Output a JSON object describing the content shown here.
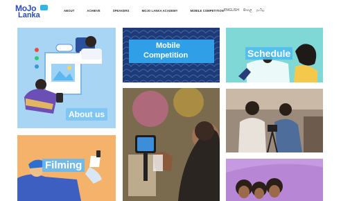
{
  "logo": {
    "line1": "MoJo",
    "line2": "Lanka"
  },
  "nav": {
    "items": [
      "ABOUT",
      "ACHIEVE",
      "SPEAKERS",
      "MOJO LANKA ACADEMY",
      "MOBILE COMPETITION"
    ]
  },
  "languages": [
    "ENGLISH",
    "සිංහල",
    "தமிழ்"
  ],
  "tiles": {
    "about": {
      "label": "About us"
    },
    "mobile": {
      "line1": "Mobile",
      "line2": "Competition"
    },
    "schedule": {
      "label": "Schedule"
    },
    "filming": {
      "label": "Filming"
    }
  },
  "colors": {
    "brand_blue": "#2b4bb4",
    "about_bg": "#a9d5f5",
    "mobile_bg": "#1d3b78",
    "mobile_box": "#2f9fe8",
    "schedule_bg": "#7fd8d6",
    "filming_bg": "#f5b26b",
    "purple_bg": "#b787d6"
  }
}
